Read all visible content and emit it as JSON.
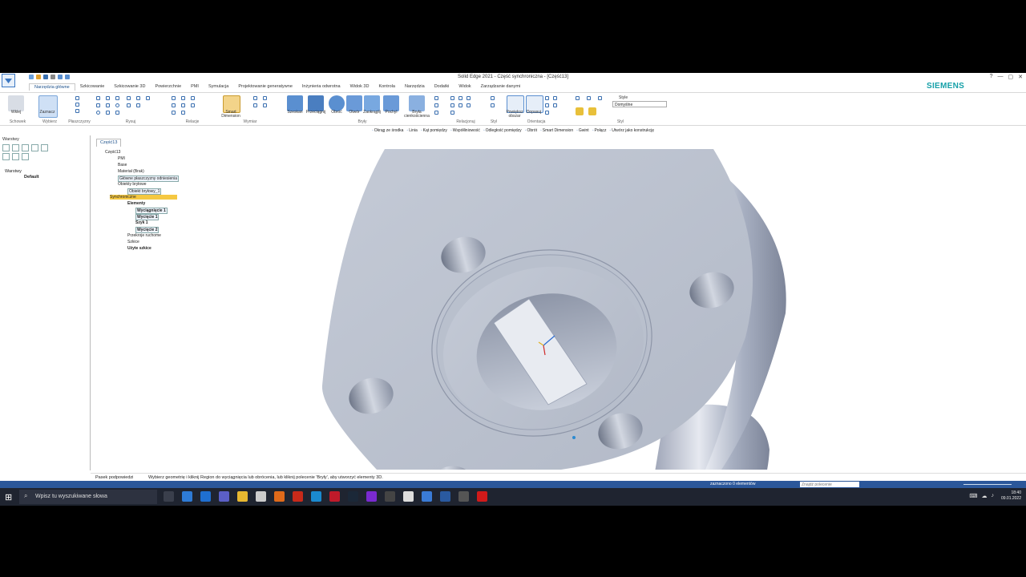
{
  "window": {
    "title": "Solid Edge 2021 - Część synchroniczna - [Część13]",
    "brand": "SIEMENS",
    "controls": [
      "?",
      "—",
      "▢",
      "✕"
    ]
  },
  "ribbon": {
    "tabs": [
      "Narzędzia główne",
      "Szkicowanie",
      "Szkicowanie 3D",
      "Powierzchnie",
      "PMI",
      "Symulacja",
      "Projektowanie generatywne",
      "Inżynieria odwrotna",
      "Widok 3D",
      "Kontrola",
      "Narzędzia",
      "Dodatki",
      "Widok",
      "Zarządzanie danymi"
    ],
    "active_tab": "Narzędzia główne",
    "groups": {
      "schowek": "Schowek",
      "wybierz": "Wybierz",
      "plaszczyzny": "Płaszczyzny",
      "rysuj": "Rysuj",
      "relacje": "Relacje",
      "wymiar": "Wymiar",
      "bryly": "Bryły",
      "relacjonuj": "Relacjonuj",
      "styl": "Styl",
      "orientacja": "Orientacja",
      "styl2": "Styl"
    },
    "buttons": {
      "wklej": "Wklej",
      "zaznacz": "Zaznacz",
      "smart_dimension": "Smart Dimension",
      "szeskan": "Szeskan",
      "przeciagnij": "Przeciągnij",
      "obroc": "Obróć",
      "otwor": "Otwór",
      "zaokraglij": "Zaokrąglij",
      "pochyl": "Pochyl",
      "bryla_cienkoscienna": "Bryła cienkościenna",
      "powieksz_obszar": "Powiększ obszar",
      "dopasuj": "Dopasuj"
    },
    "style_label": "Style",
    "style_value": "Domyślne"
  },
  "command_bar": [
    "Okrąg ze środka",
    "Linia",
    "Kąt pomiędzy",
    "Współliniowość",
    "Odległość pomiędzy",
    "Obrót",
    "Smart Dimension",
    "Gwint",
    "Połącz",
    "Utwórz jako konstrukcję"
  ],
  "layers_pane": {
    "title": "Warstwy",
    "items": [
      "Warstwy",
      "Default"
    ]
  },
  "document_tab": "Część13",
  "pathfinder": [
    {
      "label": "Część13",
      "level": 0
    },
    {
      "label": "PMI",
      "level": 1
    },
    {
      "label": "Base",
      "level": 1
    },
    {
      "label": "Materiał (Brak)",
      "level": 1
    },
    {
      "label": "Główne płaszczyzny odniesienia",
      "level": 1
    },
    {
      "label": "Obiekty bryłowe",
      "level": 1
    },
    {
      "label": "Obiekt bryłowy_1",
      "level": 2
    },
    {
      "label": "Synchroniczne",
      "level": 1
    },
    {
      "label": "Elementy",
      "level": 2
    },
    {
      "label": "Wyciągnięcie 1",
      "level": 3
    },
    {
      "label": "Wycięcie 1",
      "level": 3
    },
    {
      "label": "Szyk 1",
      "level": 3
    },
    {
      "label": "Wycięcie 2",
      "level": 3
    },
    {
      "label": "Przekroje ruchome",
      "level": 2
    },
    {
      "label": "Szkice",
      "level": 2
    },
    {
      "label": "Użyte szkice",
      "level": 2
    }
  ],
  "prompt_bar": {
    "label": "Pasek podpowiedzi",
    "text": "Wybierz geometrię i kliknij Region do wyciągnięcia lub obrócenia, lub kliknij polecenie 'Bryły', aby utworzyć elementy 3D."
  },
  "status_bar": {
    "selection": "zaznaczono 0 elementów",
    "search_placeholder": "Znajdź polecenie"
  },
  "taskbar": {
    "search_placeholder": "Wpisz tu wyszukiwane słowa",
    "time": "18:40",
    "date": "09.01.2022"
  },
  "colors": {
    "accent": "#2b579a",
    "brand": "#15a0a8",
    "highlight": "#f5c842",
    "part": "#b8c2d2"
  }
}
